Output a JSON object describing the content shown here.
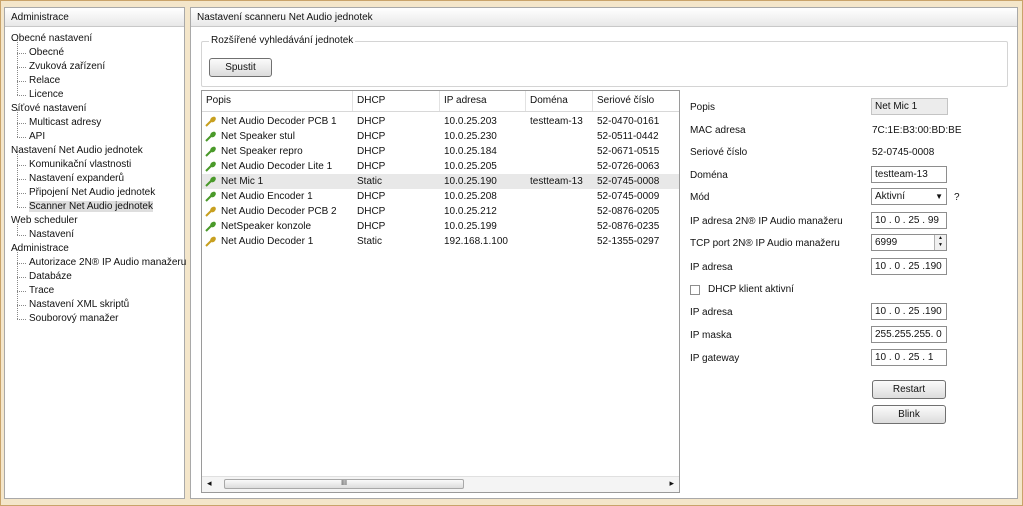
{
  "sidebar": {
    "title": "Administrace",
    "tree": [
      {
        "label": "Obecné nastavení",
        "level": 0
      },
      {
        "label": "Obecné",
        "level": 1
      },
      {
        "label": "Zvuková zařízení",
        "level": 1
      },
      {
        "label": "Relace",
        "level": 1
      },
      {
        "label": "Licence",
        "level": 1
      },
      {
        "label": "Síťové nastavení",
        "level": 0
      },
      {
        "label": "Multicast adresy",
        "level": 1
      },
      {
        "label": "API",
        "level": 1
      },
      {
        "label": "Nastavení Net Audio jednotek",
        "level": 0
      },
      {
        "label": "Komunikační vlastnosti",
        "level": 1
      },
      {
        "label": "Nastavení expanderů",
        "level": 1
      },
      {
        "label": "Připojení Net Audio jednotek",
        "level": 1
      },
      {
        "label": "Scanner Net Audio jednotek",
        "level": 1,
        "selected": true
      },
      {
        "label": "Web scheduler",
        "level": 0
      },
      {
        "label": "Nastavení",
        "level": 1
      },
      {
        "label": "Administrace",
        "level": 0
      },
      {
        "label": "Autorizace 2N® IP Audio manažeru",
        "level": 1
      },
      {
        "label": "Databáze",
        "level": 1
      },
      {
        "label": "Trace",
        "level": 1
      },
      {
        "label": "Nastavení XML skriptů",
        "level": 1
      },
      {
        "label": "Souborový manažer",
        "level": 1
      }
    ]
  },
  "main": {
    "title": "Nastavení scanneru Net Audio jednotek",
    "search": {
      "title": "Rozšířené vyhledávání jednotek",
      "start_label": "Spustit"
    },
    "table": {
      "columns": [
        "Popis",
        "DHCP",
        "IP adresa",
        "Doména",
        "Seriové číslo"
      ],
      "rows": [
        {
          "popis": "Net Audio Decoder PCB 1",
          "dhcp": "DHCP",
          "ip": "10.0.25.203",
          "domena": "testteam-13",
          "serial": "52-0470-0161",
          "icon": "gold"
        },
        {
          "popis": "Net Speaker stul",
          "dhcp": "DHCP",
          "ip": "10.0.25.230",
          "domena": "",
          "serial": "52-0511-0442",
          "icon": "green"
        },
        {
          "popis": "Net Speaker repro",
          "dhcp": "DHCP",
          "ip": "10.0.25.184",
          "domena": "",
          "serial": "52-0671-0515",
          "icon": "green"
        },
        {
          "popis": "Net Audio Decoder Lite 1",
          "dhcp": "DHCP",
          "ip": "10.0.25.205",
          "domena": "",
          "serial": "52-0726-0063",
          "icon": "green"
        },
        {
          "popis": "Net Mic 1",
          "dhcp": "Static",
          "ip": "10.0.25.190",
          "domena": "testteam-13",
          "serial": "52-0745-0008",
          "icon": "green",
          "selected": true
        },
        {
          "popis": "Net Audio Encoder 1",
          "dhcp": "DHCP",
          "ip": "10.0.25.208",
          "domena": "",
          "serial": "52-0745-0009",
          "icon": "green"
        },
        {
          "popis": "Net Audio Decoder PCB 2",
          "dhcp": "DHCP",
          "ip": "10.0.25.212",
          "domena": "",
          "serial": "52-0876-0205",
          "icon": "gold"
        },
        {
          "popis": "NetSpeaker konzole",
          "dhcp": "DHCP",
          "ip": "10.0.25.199",
          "domena": "",
          "serial": "52-0876-0235",
          "icon": "green"
        },
        {
          "popis": "Net Audio Decoder 1",
          "dhcp": "Static",
          "ip": "192.168.1.100",
          "domena": "",
          "serial": "52-1355-0297",
          "icon": "gold"
        }
      ]
    },
    "scroll_thumb_glyph": "III",
    "props": {
      "popis_label": "Popis",
      "popis_value": "Net Mic 1",
      "mac_label": "MAC adresa",
      "mac_value": "7C:1E:B3:00:BD:BE",
      "serial_label": "Seriové číslo",
      "serial_value": "52-0745-0008",
      "domain_label": "Doména",
      "domain_value": "testteam-13",
      "mode_label": "Mód",
      "mode_value": "Aktivní",
      "mode_help": "?",
      "mgr_ip_label": "IP adresa 2N® IP Audio manažeru",
      "mgr_ip_value": "10 . 0 . 25 . 99",
      "mgr_port_label": "TCP port 2N® IP Audio manažeru",
      "mgr_port_value": "6999",
      "ip_label": "IP adresa",
      "ip_value": "10 . 0 . 25 .190",
      "dhcp_label": "DHCP klient aktivní",
      "ip2_label": "IP adresa",
      "ip2_value": "10 . 0 . 25 .190",
      "mask_label": "IP maska",
      "mask_value": "255.255.255. 0",
      "gw_label": "IP gateway",
      "gw_value": "10 . 0 . 25 . 1",
      "restart_label": "Restart",
      "blink_label": "Blink"
    }
  },
  "colors": {
    "frame": "#f4e6ca",
    "mic_green": "#4a9a2a",
    "mic_gold": "#c8a020"
  }
}
